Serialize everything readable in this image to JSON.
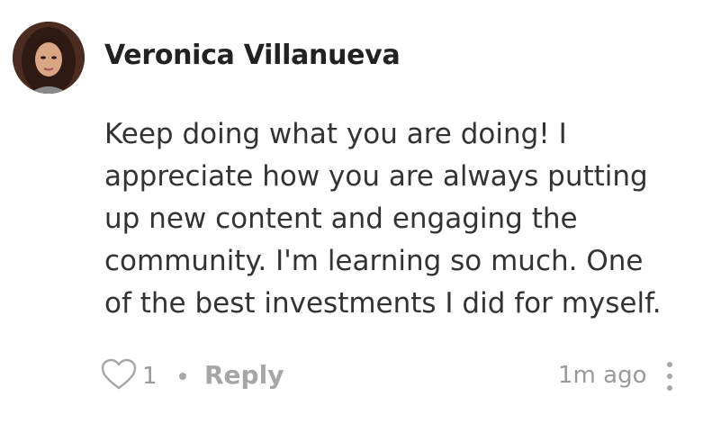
{
  "comment": {
    "author": "Veronica Villanueva",
    "avatar_alt": "avatar",
    "body_lines": [
      "Keep doing what you are doing! I",
      "appreciate how you are always putting",
      "up new content and engaging the",
      "community. I'm learning so much. One",
      "of the best investments I did for myself."
    ],
    "likes": "1",
    "reply_label": "Reply",
    "timestamp": "1m ago"
  },
  "icons": {
    "like": "heart-outline-icon",
    "more": "vertical-ellipsis-icon"
  },
  "colors": {
    "text": "#333333",
    "author": "#222222",
    "muted": "#9a9a9a"
  }
}
